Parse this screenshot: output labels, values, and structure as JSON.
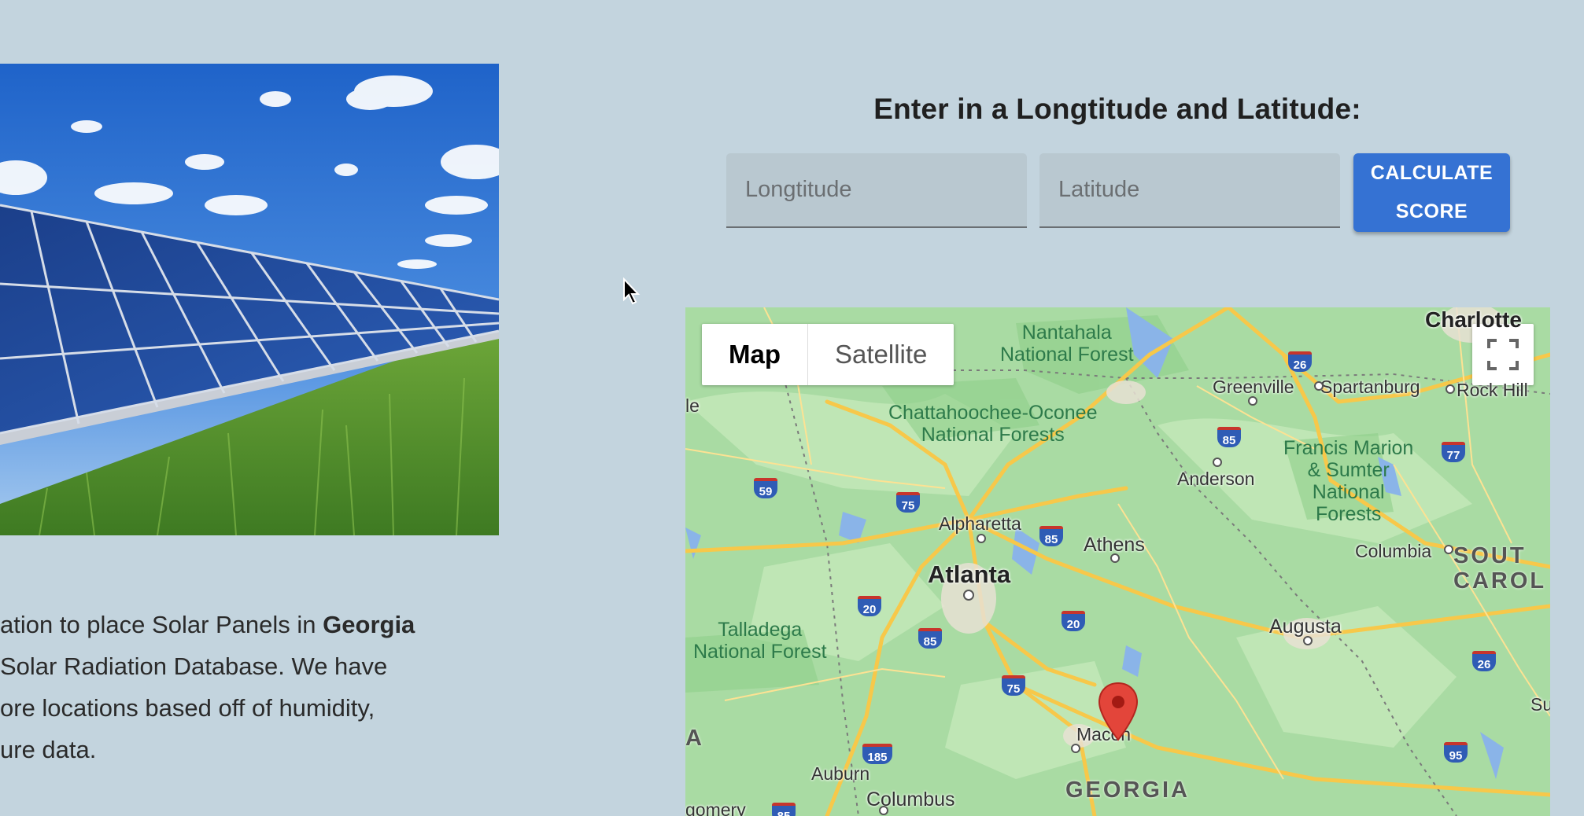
{
  "description": {
    "line1_prefix": "ation to place Solar Panels in ",
    "line1_bold": "Georgia",
    "line2": "Solar Radiation Database. We have",
    "line3": "ore locations based off of humidity,",
    "line4": "ure data."
  },
  "input_panel": {
    "title": "Enter in a Longtitude and Latitude:",
    "longitude_placeholder": "Longtitude",
    "latitude_placeholder": "Latitude",
    "calculate_line1": "CALCULATE",
    "calculate_line2": "SCORE"
  },
  "map": {
    "type_map": "Map",
    "type_satellite": "Satellite",
    "labels": {
      "nantahala": "Nantahala\nNational Forest",
      "chattahoochee": "Chattahoochee-Oconee\nNational Forests",
      "francis": "Francis Marion\n& Sumter\nNational\nForests",
      "talladega": "Talladega\nNational Forest",
      "charlotte": "Charlotte",
      "greenville": "Greenville",
      "spartanburg": "Spartanburg",
      "rock_hill": "Rock Hill",
      "anderson": "Anderson",
      "alpharetta": "Alpharetta",
      "athens": "Athens",
      "atlanta": "Atlanta",
      "columbia": "Columbia",
      "south_carolina": "SOUT\nCAROL",
      "augusta": "Augusta",
      "macon": "Macon",
      "auburn": "Auburn",
      "columbus": "Columbus",
      "georgia": "GEORGIA",
      "le": "le",
      "a": "A",
      "gomery": "gomery",
      "sun": "Sun"
    },
    "shields": [
      "26",
      "85",
      "77",
      "59",
      "75",
      "85",
      "20",
      "85",
      "20",
      "75",
      "185",
      "26",
      "95",
      "85"
    ]
  }
}
